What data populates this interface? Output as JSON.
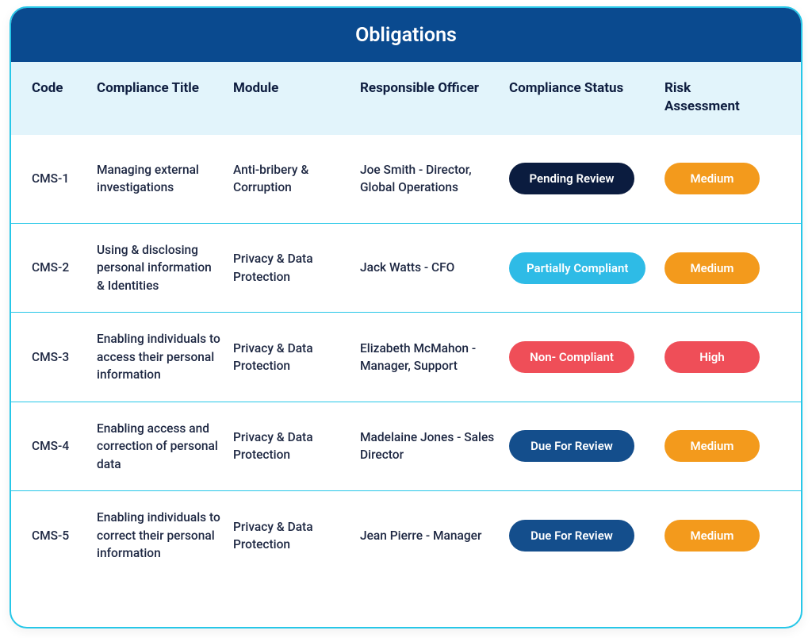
{
  "title": "Obligations",
  "columns": {
    "code": "Code",
    "compliance_title": "Compliance Title",
    "module": "Module",
    "officer": "Responsible Officer",
    "status": "Compliance Status",
    "risk": "Risk Assessment"
  },
  "status_colors": {
    "Pending Review": "#0b1c3f",
    "Partially Compliant": "#2ebbe6",
    "Non- Compliant": "#ef4e58",
    "Due For Review": "#144e8c"
  },
  "risk_colors": {
    "Medium": "#f39a1c",
    "High": "#ef4e58"
  },
  "rows": [
    {
      "code": "CMS-1",
      "compliance_title": "Managing external investigations",
      "module": "Anti-bribery & Corruption",
      "officer": "Joe Smith - Director, Global Operations",
      "status": "Pending Review",
      "risk": "Medium"
    },
    {
      "code": "CMS-2",
      "compliance_title": "Using & disclosing personal information & Identities",
      "module": "Privacy & Data Protection",
      "officer": "Jack Watts - CFO",
      "status": "Partially Compliant",
      "risk": "Medium"
    },
    {
      "code": "CMS-3",
      "compliance_title": "Enabling individuals to access their personal information",
      "module": "Privacy & Data Protection",
      "officer": "Elizabeth McMahon - Manager, Support",
      "status": "Non- Compliant",
      "risk": "High"
    },
    {
      "code": "CMS-4",
      "compliance_title": "Enabling access and correction of personal data",
      "module": "Privacy & Data Protection",
      "officer": "Madelaine Jones - Sales Director",
      "status": "Due For Review",
      "risk": "Medium"
    },
    {
      "code": "CMS-5",
      "compliance_title": "Enabling individuals to correct their personal information",
      "module": "Privacy & Data Protection",
      "officer": "Jean Pierre - Manager",
      "status": "Due For Review",
      "risk": "Medium"
    }
  ]
}
